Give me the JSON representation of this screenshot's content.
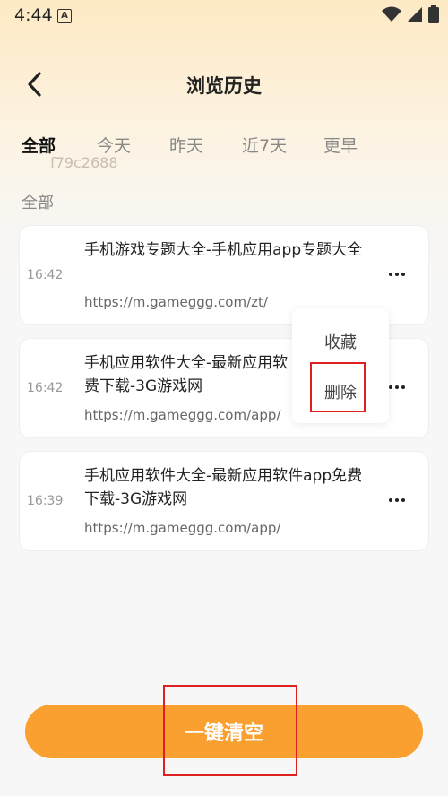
{
  "status_bar": {
    "time": "4:44",
    "app_icon_glyph": "A"
  },
  "header": {
    "title": "浏览历史",
    "back_icon": "chevron-left-icon"
  },
  "tabs": [
    {
      "label": "全部",
      "active": true
    },
    {
      "label": "今天",
      "active": false
    },
    {
      "label": "昨天",
      "active": false
    },
    {
      "label": "近7天",
      "active": false
    },
    {
      "label": "更早",
      "active": false
    }
  ],
  "watermark": "f79c2688",
  "section_label": "全部",
  "history": [
    {
      "time": "16:42",
      "title": "手机游戏专题大全-手机应用app专题大全",
      "url": "https://m.gameggg.com/zt/"
    },
    {
      "time": "16:42",
      "title": "手机应用软件大全-最新应用软",
      "title_line2": "费下载-3G游戏网",
      "url": "https://m.gameggg.com/app/"
    },
    {
      "time": "16:39",
      "title": "手机应用软件大全-最新应用软件app免费下载-3G游戏网",
      "url": "https://m.gameggg.com/app/"
    }
  ],
  "context_menu": {
    "items": [
      "收藏",
      "删除"
    ]
  },
  "clear_button": {
    "label": "一键清空"
  },
  "colors": {
    "accent": "#f9a030",
    "highlight": "#e02020"
  }
}
